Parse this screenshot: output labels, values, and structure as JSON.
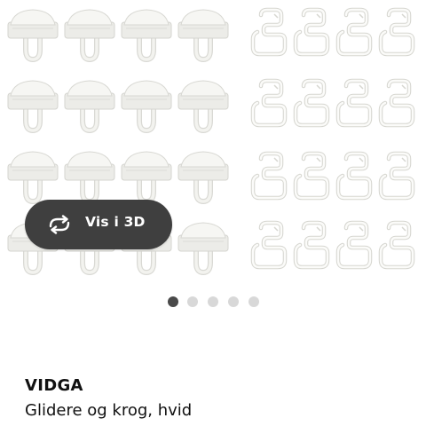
{
  "gallery": {
    "view_3d_label": "Vis i 3D",
    "view_3d_icon": "rotate-arrows-icon",
    "slide_count": 5,
    "active_slide": 1
  },
  "product": {
    "name": "VIDGA",
    "description": "Glidere og krog, hvid"
  }
}
